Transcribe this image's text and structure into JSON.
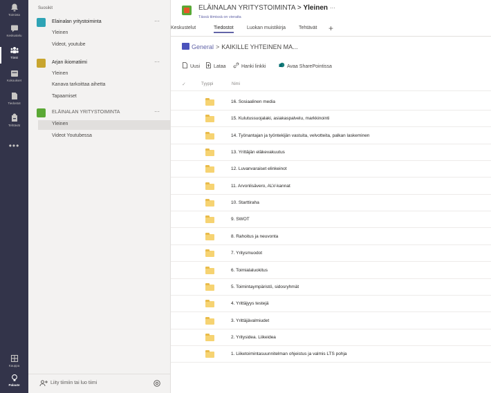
{
  "rail": {
    "items": [
      {
        "label": "Toiminta",
        "icon": "bell-icon"
      },
      {
        "label": "Keskustelu",
        "icon": "chat-icon"
      },
      {
        "label": "Tiimit",
        "icon": "teams-icon"
      },
      {
        "label": "Kokoukset",
        "icon": "calendar-icon"
      },
      {
        "label": "Tiedostot",
        "icon": "files-icon"
      },
      {
        "label": "Tehtävät",
        "icon": "tasks-icon"
      }
    ],
    "more": "•••",
    "store_label": "Kauppa",
    "feedback_label": "Palaute"
  },
  "teams_panel": {
    "section_label": "Suosikit",
    "teams": [
      {
        "name": "Elainalan yritystoiminta",
        "logo_color": "#2ea3b5",
        "more": "···",
        "channels": [
          "Yleinen",
          "Videot, youtube"
        ]
      },
      {
        "name": "Arjan ikiomatiimi",
        "logo_color": "#c8a52f",
        "more": "···",
        "channels": [
          "Yleinen",
          "Kanava tarkoittaa aihetta",
          "Tapaamiset"
        ]
      },
      {
        "name": "ELÄINALAN YRITYSTOIMINTA",
        "logo_color": "#5aa835",
        "more": "···",
        "channels": [
          "Yleinen",
          "Videot Youtubessa"
        ]
      }
    ],
    "join_label": "Liity tiimiin tai luo tiimi"
  },
  "header": {
    "team": "ELÄINALAN YRITYSTOIMINTA",
    "separator": ">",
    "channel": "Yleinen",
    "more": "···",
    "subtitle": "Tässä tiimissä on vieraita"
  },
  "tabs": [
    {
      "label": "Keskustelut"
    },
    {
      "label": "Tiedostot"
    },
    {
      "label": "Luokan muistikirja"
    },
    {
      "label": "Tehtävät"
    }
  ],
  "tab_add": "+",
  "breadcrumb": {
    "root": "General",
    "separator": ">",
    "current": "KAIKILLE YHTEINEN MA..."
  },
  "toolbar": {
    "new": "Uusi",
    "upload": "Lataa",
    "get_link": "Hanki linkki",
    "sharepoint": "Avaa SharePointissa"
  },
  "list": {
    "check": "✓",
    "type_header": "Tyyppi",
    "name_header": "Nimi",
    "items": [
      "16. Sosiaalinen media",
      "15. Kulutussuojalaki, asiakaspalvelu, markkinointi",
      "14. Työnantajan ja työntekijän vastuita, velvotteita, palkan laskeminen",
      "13. Yrittäjän eläkevakuutus",
      "12. Luvanvaraiset elinkeinot",
      "11. Arvonlisävero, ALV-kannat",
      "10. Starttiraha",
      "9. SWOT",
      "8. Rahoitus ja neuvonta",
      "7. Yritysmuodot",
      "6. Toimialaluokitus",
      "5. Toimintaympäristö, sidosryhmät",
      "4. Yrittäjyys testejä",
      "3. Yrittäjävalmiudet",
      "2. Yritysidea. Liikeidea",
      "1. Liiketoimintasuunnitelman ohjeistus ja valmis LTS pohja"
    ]
  }
}
